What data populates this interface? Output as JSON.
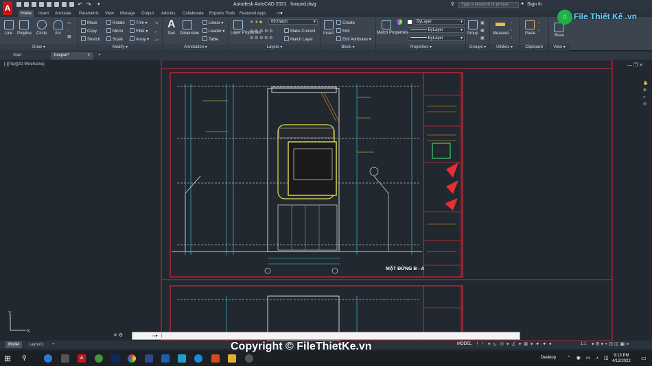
{
  "titlebar": {
    "app_logo": "A",
    "title": "Autodesk AutoCAD 2021",
    "filename": "hoxpxd.dwg",
    "search_placeholder": "Type a keyword or phrase",
    "sign_in": "Sign In"
  },
  "ribbon_tabs": [
    "Home",
    "Insert",
    "Annotate",
    "Parametric",
    "View",
    "Manage",
    "Output",
    "Add-ins",
    "Collaborate",
    "Express Tools",
    "Featured Apps"
  ],
  "ribbon": {
    "draw": {
      "label": "Draw",
      "line": "Line",
      "polyline": "Polyline",
      "circle": "Circle",
      "arc": "Arc"
    },
    "modify": {
      "label": "Modify",
      "move": "Move",
      "copy": "Copy",
      "stretch": "Stretch",
      "rotate": "Rotate",
      "mirror": "Mirror",
      "scale": "Scale",
      "trim": "Trim",
      "fillet": "Fillet",
      "array": "Array"
    },
    "annotation": {
      "label": "Annotation",
      "text": "Text",
      "dimension": "Dimension",
      "linear": "Linear",
      "leader": "Leader",
      "table": "Table"
    },
    "layers": {
      "label": "Layers",
      "layer_properties": "Layer Properties",
      "current_layer": "09.Hatch",
      "make_current": "Make Current",
      "match_layer": "Match Layer"
    },
    "block": {
      "label": "Block",
      "insert": "Insert",
      "create": "Create",
      "edit": "Edit",
      "edit_attributes": "Edit Attributes"
    },
    "properties": {
      "label": "Properties",
      "match_properties": "Match Properties",
      "color": "ByLayer",
      "linetype": "ByLayer",
      "lineweight": "ByLayer"
    },
    "groups": {
      "label": "Groups",
      "group": "Group"
    },
    "utilities": {
      "label": "Utilities",
      "measure": "Measure"
    },
    "clipboard": {
      "label": "Clipboard",
      "paste": "Paste"
    },
    "view": {
      "label": "View",
      "base": "Base"
    }
  },
  "doc_tabs": [
    "Start",
    "hoxpxd*"
  ],
  "viewport": {
    "label": "[-][Top][2D Wireframe]"
  },
  "drawing": {
    "elevation_title": "MẶT ĐỨNG B - A"
  },
  "command": {
    "placeholder": ""
  },
  "layout_tabs": [
    "Model",
    "Layout1"
  ],
  "status": {
    "model": "MODEL",
    "scale": "1:1"
  },
  "taskbar": {
    "desktop": "Desktop",
    "time": "9:13 PM",
    "date": "4/12/2022"
  },
  "watermark": {
    "brand": "File Thiết Kế .vn",
    "copyright": "Copyright © FileThietKe.vn"
  },
  "colors": {
    "accent": "#c4161c",
    "cad_red": "#d8283a",
    "cad_yellow": "#e8e04a",
    "cad_green": "#3fd06a",
    "cad_cyan": "#4ad8e0"
  }
}
